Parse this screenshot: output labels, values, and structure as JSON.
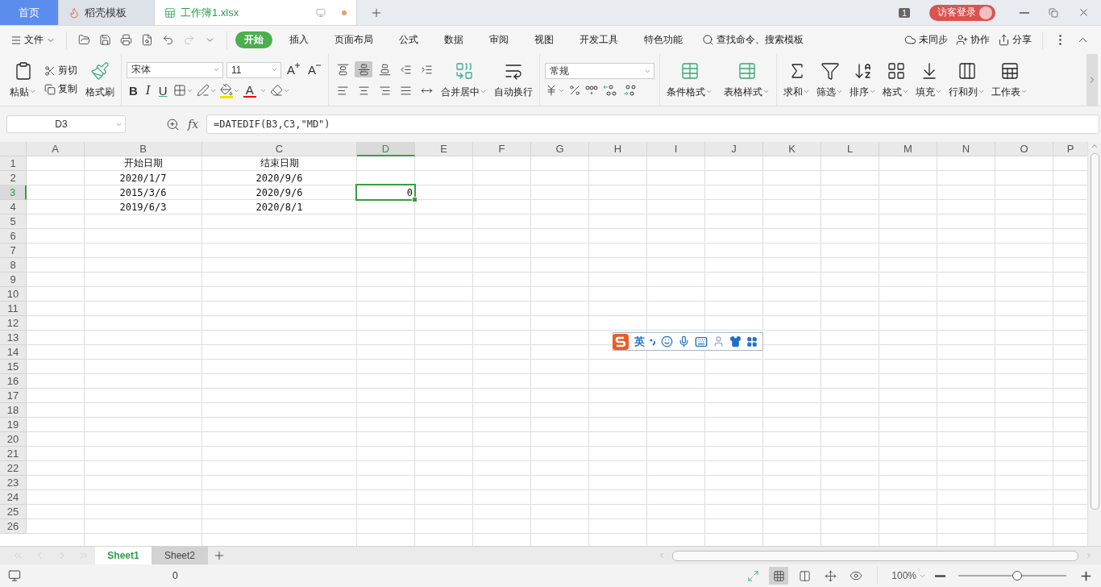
{
  "doc_tabs": [
    {
      "kind": "home",
      "label": "首页",
      "selected": false
    },
    {
      "kind": "template",
      "label": "稻壳模板",
      "selected": false
    },
    {
      "kind": "sheet",
      "label": "工作簿1.xlsx",
      "selected": true
    }
  ],
  "title_bar": {
    "badge": "1",
    "login": "访客登录"
  },
  "menu": {
    "file": "文件",
    "tabs": [
      {
        "label": "开始",
        "selected": true
      },
      {
        "label": "插入",
        "selected": false
      },
      {
        "label": "页面布局",
        "selected": false
      },
      {
        "label": "公式",
        "selected": false
      },
      {
        "label": "数据",
        "selected": false
      },
      {
        "label": "审阅",
        "selected": false
      },
      {
        "label": "视图",
        "selected": false
      },
      {
        "label": "开发工具",
        "selected": false
      },
      {
        "label": "特色功能",
        "selected": false
      }
    ],
    "search": "查找命令、搜索模板",
    "sync": "未同步",
    "collab": "协作",
    "share": "分享"
  },
  "ribbon": {
    "clipboard": {
      "paste": "粘贴",
      "cut": "剪切",
      "copy": "复制",
      "painter": "格式刷"
    },
    "font": {
      "name": "宋体",
      "size": "11",
      "grow_label": "A",
      "shrink_label": "A",
      "bold": "B",
      "italic": "I",
      "underline": "U",
      "font_color_label": "A"
    },
    "align_buttons": [
      {
        "kind": "top",
        "selected": false
      },
      {
        "kind": "middle",
        "selected": true
      },
      {
        "kind": "bottom",
        "selected": false
      },
      {
        "kind": "outdent",
        "selected": false
      },
      {
        "kind": "indent",
        "selected": false
      },
      {
        "kind": "left",
        "selected": false
      },
      {
        "kind": "center",
        "selected": false
      },
      {
        "kind": "right",
        "selected": false
      },
      {
        "kind": "justify",
        "selected": false
      },
      {
        "kind": "distributed",
        "selected": false
      }
    ],
    "merge": "合并居中",
    "wrap": "自动换行",
    "number_format": "常规",
    "styles": [
      {
        "kind": "conditional",
        "label": "条件格式"
      },
      {
        "kind": "table",
        "label": "表格样式"
      }
    ],
    "tools": [
      {
        "kind": "sum",
        "label": "求和"
      },
      {
        "kind": "filter",
        "label": "筛选"
      },
      {
        "kind": "sort",
        "label": "排序"
      },
      {
        "kind": "format",
        "label": "格式"
      },
      {
        "kind": "fill",
        "label": "填充"
      },
      {
        "kind": "rowcol",
        "label": "行和列"
      },
      {
        "kind": "sheet",
        "label": "工作表"
      }
    ]
  },
  "formula_bar": {
    "name_box": "D3",
    "fx": "fx",
    "formula": "=DATEDIF(B3,C3,\"MD\")"
  },
  "grid": {
    "columns": [
      {
        "label": "A",
        "selected": false
      },
      {
        "label": "B",
        "selected": false
      },
      {
        "label": "C",
        "selected": false
      },
      {
        "label": "D",
        "selected": true
      },
      {
        "label": "E",
        "selected": false
      },
      {
        "label": "F",
        "selected": false
      },
      {
        "label": "G",
        "selected": false
      },
      {
        "label": "H",
        "selected": false
      },
      {
        "label": "I",
        "selected": false
      },
      {
        "label": "J",
        "selected": false
      },
      {
        "label": "K",
        "selected": false
      },
      {
        "label": "L",
        "selected": false
      },
      {
        "label": "M",
        "selected": false
      },
      {
        "label": "N",
        "selected": false
      },
      {
        "label": "O",
        "selected": false
      },
      {
        "label": "P",
        "selected": false
      }
    ],
    "rows": [
      {
        "label": "1",
        "selected": false,
        "cells": [
          {
            "kind": "empty"
          },
          {
            "kind": "text",
            "text": "开始日期",
            "selected": false
          },
          {
            "kind": "text",
            "text": "结束日期",
            "selected": false
          }
        ]
      },
      {
        "label": "2",
        "selected": false,
        "cells": [
          {
            "kind": "empty"
          },
          {
            "kind": "text",
            "text": "2020/1/7",
            "selected": false
          },
          {
            "kind": "text",
            "text": "2020/9/6",
            "selected": false
          }
        ]
      },
      {
        "label": "3",
        "selected": true,
        "cells": [
          {
            "kind": "empty"
          },
          {
            "kind": "text",
            "text": "2015/3/6",
            "selected": false
          },
          {
            "kind": "text",
            "text": "2020/9/6",
            "selected": false
          },
          {
            "kind": "number",
            "text": "0",
            "selected": true
          }
        ]
      },
      {
        "label": "4",
        "selected": false,
        "cells": [
          {
            "kind": "empty"
          },
          {
            "kind": "text",
            "text": "2019/6/3",
            "selected": false
          },
          {
            "kind": "text",
            "text": "2020/8/1",
            "selected": false
          }
        ]
      },
      {
        "label": "5",
        "selected": false
      },
      {
        "label": "6",
        "selected": false
      },
      {
        "label": "7",
        "selected": false
      },
      {
        "label": "8",
        "selected": false
      },
      {
        "label": "9",
        "selected": false
      },
      {
        "label": "10",
        "selected": false
      },
      {
        "label": "11",
        "selected": false
      },
      {
        "label": "12",
        "selected": false
      },
      {
        "label": "13",
        "selected": false
      },
      {
        "label": "14",
        "selected": false
      },
      {
        "label": "15",
        "selected": false
      },
      {
        "label": "16",
        "selected": false
      },
      {
        "label": "17",
        "selected": false
      },
      {
        "label": "18",
        "selected": false
      },
      {
        "label": "19",
        "selected": false
      },
      {
        "label": "20",
        "selected": false
      },
      {
        "label": "21",
        "selected": false
      },
      {
        "label": "22",
        "selected": false
      },
      {
        "label": "23",
        "selected": false
      },
      {
        "label": "24",
        "selected": false
      },
      {
        "label": "25",
        "selected": false
      },
      {
        "label": "26",
        "selected": false
      }
    ]
  },
  "ime_toolbar": {
    "mode": "英"
  },
  "sheets": [
    {
      "label": "Sheet1",
      "selected": true
    },
    {
      "label": "Sheet2",
      "selected": false
    }
  ],
  "status_bar": {
    "value": "0",
    "zoom": "100%",
    "zoom_level": {
      "level": 0.55
    }
  }
}
